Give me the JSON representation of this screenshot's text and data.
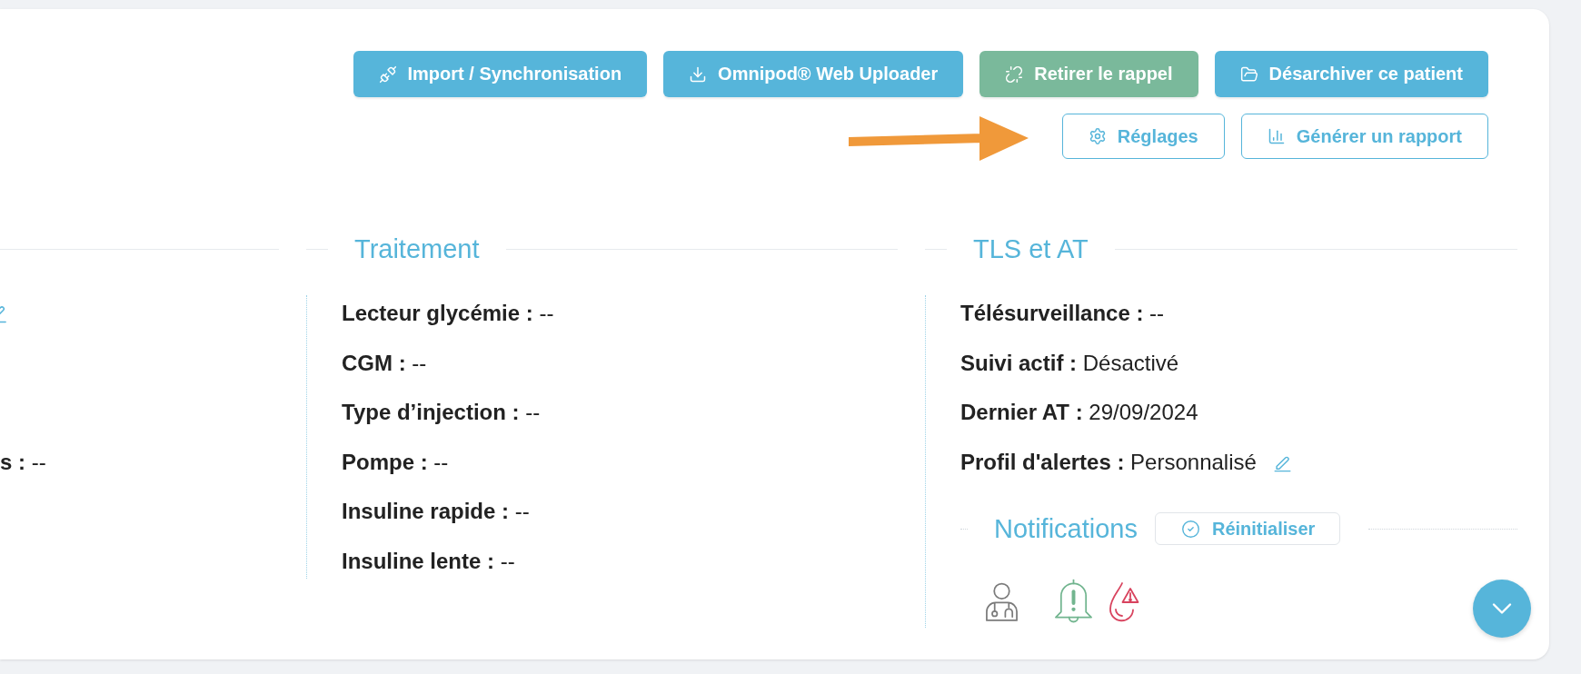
{
  "annotation": {
    "kind": "arrow"
  },
  "button_rows": [
    {
      "buttons": [
        {
          "label": "Import / Synchronisation",
          "kind": "filled",
          "color": "#56b5da"
        },
        {
          "label": "Omnipod® Web Uploader",
          "kind": "filled",
          "color": "#56b5da"
        },
        {
          "label": "Retirer le rappel",
          "kind": "filled",
          "color": "#7ab99b"
        },
        {
          "label": "Désarchiver ce patient",
          "kind": "filled",
          "color": "#56b5da"
        }
      ]
    },
    {
      "buttons": [
        {
          "label": "Réglages",
          "kind": "outline"
        },
        {
          "label": "Générer un rapport",
          "kind": "outline"
        }
      ]
    }
  ],
  "sections": [
    {
      "kind": "cut",
      "edit_visible": true,
      "fields": [
        {
          "text": "**s :** --"
        }
      ]
    },
    {
      "kind": "full",
      "heading": "Traitement",
      "fields": [
        {
          "text": "**Lecteur glycémie :** --"
        },
        {
          "text": "**CGM :** --"
        },
        {
          "text": "**Type d’injection :** --"
        },
        {
          "text": "**Pompe :** --"
        },
        {
          "text": "**Insuline rapide :** --"
        },
        {
          "text": "**Insuline lente :** --"
        }
      ]
    },
    {
      "kind": "full",
      "heading": "TLS et AT",
      "fields": [
        {
          "text": "**Télésurveillance :** --",
          "editable": false
        },
        {
          "text": "**Suivi actif :** Désactivé",
          "editable": false
        },
        {
          "text": "**Dernier AT :** 29/09/2024",
          "editable": false
        },
        {
          "text": "**Profil d'alertes :** Personnalisé",
          "editable": true
        }
      ],
      "notifications": {
        "title": "Notifications",
        "reset_label": "Réinitialiser",
        "items": [
          {
            "color": "#7b7b7b"
          },
          {
            "color": "#72b58f"
          },
          {
            "color": "#d8435e"
          }
        ]
      }
    }
  ]
}
